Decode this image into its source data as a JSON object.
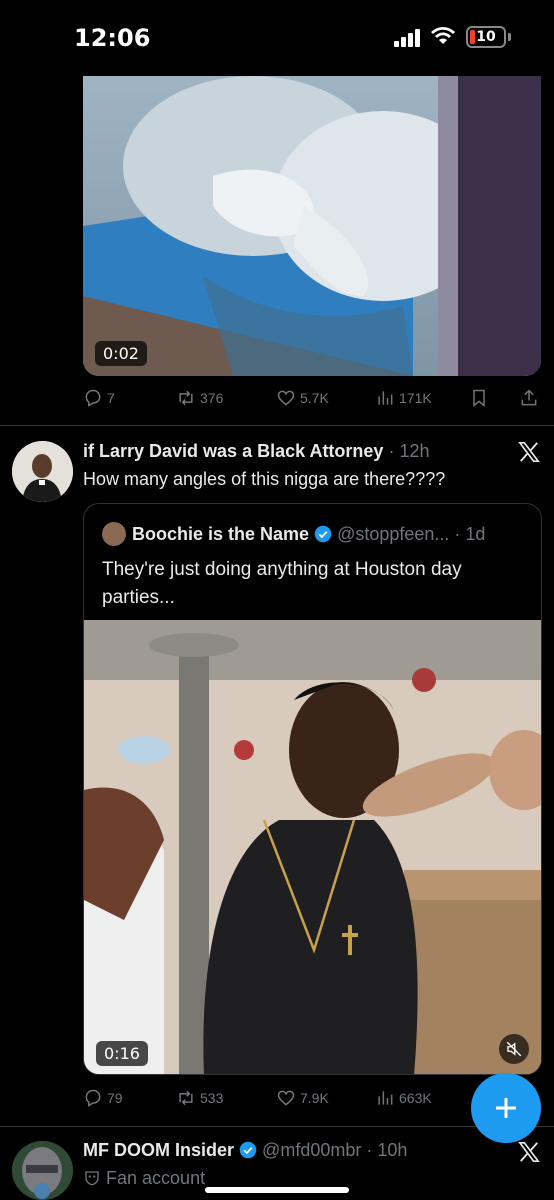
{
  "status_bar": {
    "time": "12:06",
    "battery": "10"
  },
  "tweet1": {
    "video_duration": "0:02",
    "actions": {
      "replies": "7",
      "reposts": "376",
      "likes": "5.7K",
      "views": "171K"
    }
  },
  "tweet2": {
    "author_name": "if Larry David was a Black Attorney",
    "time": "· 12h",
    "text": "How many angles of this nigga are there????",
    "quote": {
      "author_name": "Boochie is the Name",
      "handle_time": "@stoppfeen... · 1d",
      "text": "They're just doing anything at Houston day parties...",
      "video_duration": "0:16"
    },
    "actions": {
      "replies": "79",
      "reposts": "533",
      "likes": "7.9K",
      "views": "663K"
    }
  },
  "tweet3": {
    "author_name": "MF DOOM Insider",
    "handle_time": "@mfd00mbr · 10h",
    "fan_label": "Fan account"
  },
  "colors": {
    "accent": "#1d9bf0",
    "background": "#000000",
    "muted": "#71767b",
    "battery_low": "#ff3b30"
  },
  "icons": [
    "signal-icon",
    "wifi-icon",
    "battery-icon",
    "reply-icon",
    "repost-icon",
    "like-icon",
    "views-icon",
    "bookmark-icon",
    "share-icon",
    "x-logo-icon",
    "verified-icon",
    "mute-icon",
    "plus-icon",
    "fan-account-icon"
  ]
}
